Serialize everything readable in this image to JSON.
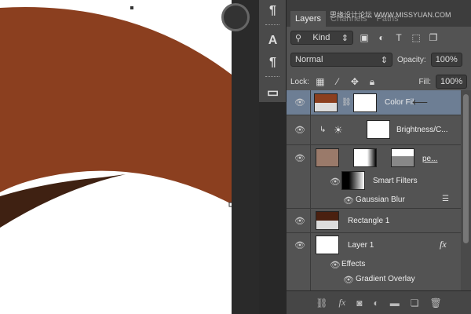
{
  "canvas": {
    "shape_color": "#8b3f1f",
    "shadow_color": "#3f2112"
  },
  "tools": [
    "paragraph-icon",
    "character-style-icon",
    "paragraph-style-icon",
    "folder-icon"
  ],
  "panel": {
    "tabs": [
      {
        "label": "Layers"
      },
      {
        "label": "Channels"
      },
      {
        "label": "Paths"
      }
    ],
    "watermark": "思缘设计论坛 WWW.MISSYUAN.COM",
    "filter": {
      "label": "Kind"
    },
    "blend_mode": "Normal",
    "opacity_label": "Opacity:",
    "opacity_value": "100%",
    "lock_label": "Lock:",
    "fill_label": "Fill:",
    "fill_value": "100%",
    "layers": [
      {
        "name": "Color Fil",
        "selected": true
      },
      {
        "name": "Brightness/C..."
      },
      {
        "name": "pe..."
      },
      {
        "name": "Smart Filters"
      },
      {
        "name": "Gaussian Blur"
      },
      {
        "name": "Rectangle 1"
      },
      {
        "name": "Layer 1",
        "fx": "fx"
      },
      {
        "name": "Effects"
      },
      {
        "name": "Gradient Overlay"
      }
    ],
    "footer_fx": "fx"
  }
}
